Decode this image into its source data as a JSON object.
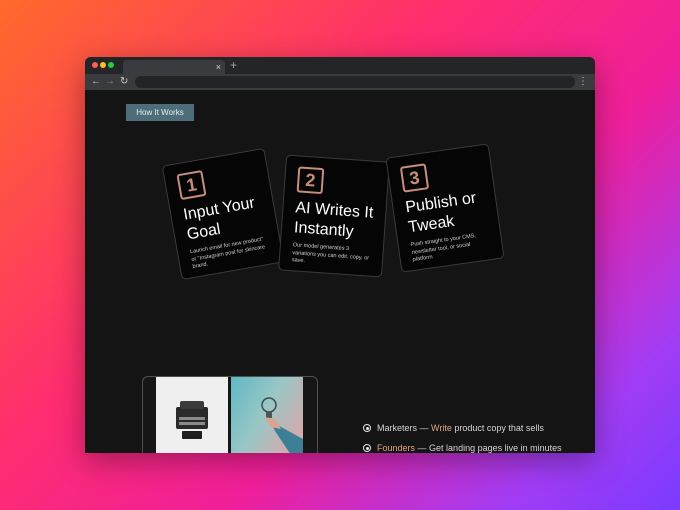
{
  "browser": {
    "tab_close": "×",
    "new_tab": "+",
    "nav_back": "←",
    "nav_forward": "→",
    "nav_reload": "↻",
    "menu": "⋮"
  },
  "page": {
    "how_button": "How It Works",
    "steps": [
      {
        "number": "1",
        "title": "Input Your Goal",
        "desc": "Launch email for new product\" or \"Instagram post for skincare brand."
      },
      {
        "number": "2",
        "title": "AI Writes It Instantly",
        "desc": "Our model generates 3 variations you can edit, copy, or save."
      },
      {
        "number": "3",
        "title": "Publish or Tweak",
        "desc": "Push straight to your CMS, newsletter tool, or social platform"
      }
    ],
    "audience": [
      {
        "who": "Marketers",
        "sep": " — ",
        "action": "Write",
        "rest": " product copy that sells"
      },
      {
        "who": "Founders",
        "sep": " — ",
        "rest": "Get landing pages live in minutes"
      }
    ]
  },
  "colors": {
    "accent": "#c98e7b",
    "button": "#4d6e79",
    "window_bg": "#141414"
  }
}
